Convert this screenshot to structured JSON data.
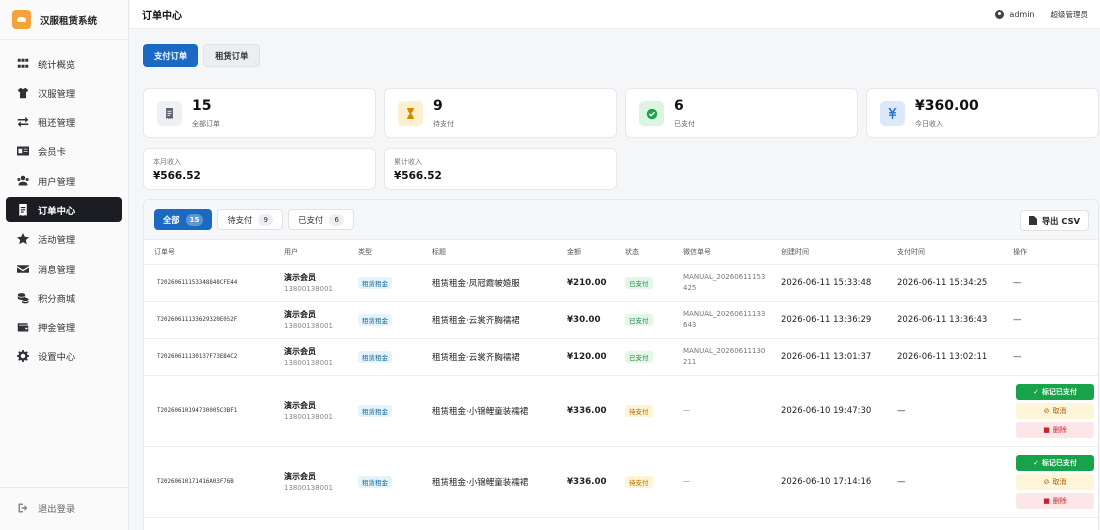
{
  "app": {
    "title": "汉服租赁系统"
  },
  "sidebar": {
    "items": [
      {
        "label": "统计概览",
        "icon": "grid-icon"
      },
      {
        "label": "汉服管理",
        "icon": "shirt-icon"
      },
      {
        "label": "租还管理",
        "icon": "exchange-icon"
      },
      {
        "label": "会员卡",
        "icon": "id-card-icon"
      },
      {
        "label": "用户管理",
        "icon": "users-icon"
      },
      {
        "label": "订单中心",
        "icon": "receipt-icon",
        "active": true
      },
      {
        "label": "活动管理",
        "icon": "star-icon"
      },
      {
        "label": "消息管理",
        "icon": "envelope-icon"
      },
      {
        "label": "积分商城",
        "icon": "coins-icon"
      },
      {
        "label": "押金管理",
        "icon": "wallet-icon"
      },
      {
        "label": "设置中心",
        "icon": "gear-icon"
      }
    ],
    "logout": "退出登录"
  },
  "header": {
    "title": "订单中心",
    "username": "admin",
    "role": "超级管理员"
  },
  "top_tabs": [
    "支付订单",
    "租赁订单"
  ],
  "stats": [
    {
      "value": "15",
      "label": "全部订单",
      "icon": "receipt-icon",
      "color": "#5a6270"
    },
    {
      "value": "9",
      "label": "待支付",
      "icon": "hourglass-icon",
      "color": "#d68a00"
    },
    {
      "value": "6",
      "label": "已支付",
      "icon": "check-circle-icon",
      "color": "#1fa34f"
    },
    {
      "value": "¥360.00",
      "label": "今日收入",
      "icon": "yen-icon",
      "color": "#2a6fd1"
    }
  ],
  "income": [
    {
      "label": "本月收入",
      "value": "¥566.52"
    },
    {
      "label": "累计收入",
      "value": "¥566.52"
    }
  ],
  "filters": [
    {
      "label": "全部",
      "count": "15"
    },
    {
      "label": "待支付",
      "count": "9"
    },
    {
      "label": "已支付",
      "count": "6"
    }
  ],
  "export_label": "导出 CSV",
  "table": {
    "headers": [
      "订单号",
      "用户",
      "类型",
      "标题",
      "金额",
      "状态",
      "微信单号",
      "创建时间",
      "支付时间",
      "操作"
    ],
    "rows": [
      {
        "order_no": "T20260611153348848CFE44",
        "user": "演示会员",
        "phone": "13800138001",
        "type": "租赁租金",
        "title": "租赁租金·凤冠霞帔婚服",
        "amount": "¥210.00",
        "status": "已支付",
        "wx1": "MANUAL_20260611153",
        "wx2": "425",
        "created": "2026-06-11 15:33:48",
        "paid": "2026-06-11 15:34:25",
        "op": "—"
      },
      {
        "order_no": "T20260611133629320E052F",
        "user": "演示会员",
        "phone": "13800138001",
        "type": "租赁租金",
        "title": "租赁租金·云裳齐胸襦裙",
        "amount": "¥30.00",
        "status": "已支付",
        "wx1": "MANUAL_20260611133",
        "wx2": "643",
        "created": "2026-06-11 13:36:29",
        "paid": "2026-06-11 13:36:43",
        "op": "—"
      },
      {
        "order_no": "T20260611130137F73EB4C2",
        "user": "演示会员",
        "phone": "13800138001",
        "type": "租赁租金",
        "title": "租赁租金·云裳齐胸襦裙",
        "amount": "¥120.00",
        "status": "已支付",
        "wx1": "MANUAL_20260611130",
        "wx2": "211",
        "created": "2026-06-11 13:01:37",
        "paid": "2026-06-11 13:02:11",
        "op": "—"
      },
      {
        "order_no": "T20260610194730005C3BF1",
        "user": "演示会员",
        "phone": "13800138001",
        "type": "租赁租金",
        "title": "租赁租金·小锦鲤童装襦裙",
        "amount": "¥336.00",
        "status": "待支付",
        "wx1": "—",
        "wx2": "",
        "created": "2026-06-10 19:47:30",
        "paid": "—",
        "actions": [
          "标记已支付",
          "取消",
          "删除"
        ]
      },
      {
        "order_no": "T20260610171416A03F76B",
        "user": "演示会员",
        "phone": "13800138001",
        "type": "租赁租金",
        "title": "租赁租金·小锦鲤童装襦裙",
        "amount": "¥336.00",
        "status": "待支付",
        "wx1": "—",
        "wx2": "",
        "created": "2026-06-10 17:14:16",
        "paid": "—",
        "actions": [
          "标记已支付",
          "取消",
          "删除"
        ]
      }
    ]
  }
}
